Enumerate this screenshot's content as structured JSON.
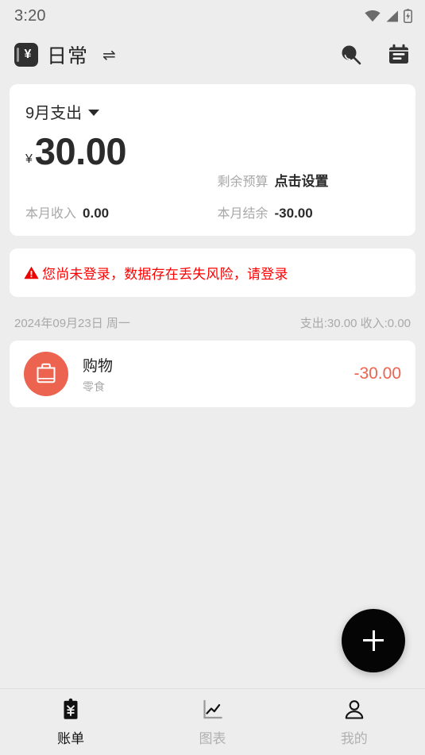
{
  "status_bar": {
    "time": "3:20",
    "icons": [
      "wifi-icon",
      "signal-icon",
      "battery-charging-icon"
    ]
  },
  "app_bar": {
    "logo_symbol": "¥",
    "logo_icon": "ledger-book-icon",
    "title": "日常",
    "swap_glyph": "⇌",
    "actions": [
      {
        "name": "search-icon",
        "label": "搜索"
      },
      {
        "name": "calendar-bill-icon",
        "label": "账本"
      }
    ]
  },
  "summary": {
    "month_label": "9月支出",
    "currency_symbol": "¥",
    "expense_amount": "30.00",
    "budget_label": "剩余预算",
    "budget_value": "点击设置",
    "income_label": "本月收入",
    "income_value": "0.00",
    "balance_label": "本月结余",
    "balance_value": "-30.00"
  },
  "warning": {
    "icon": "warning-triangle-icon",
    "text": "您尚未登录，数据存在丢失风险，请登录",
    "color": "#ff0000"
  },
  "day_group": {
    "date": "2024年09月23日 周一",
    "totals": "支出:30.00  收入:0.00"
  },
  "transactions": [
    {
      "icon": "shopping-bag-icon",
      "icon_color": "#ec6350",
      "category": "购物",
      "note": "零食",
      "amount": "-30.00",
      "amount_color": "#ec6350"
    }
  ],
  "fab": {
    "icon": "plus-icon",
    "label": "添加记账"
  },
  "bottom_nav": {
    "items": [
      {
        "icon": "bill-clipboard-icon",
        "label": "账单",
        "active": true
      },
      {
        "icon": "chart-line-icon",
        "label": "图表",
        "active": false
      },
      {
        "icon": "person-icon",
        "label": "我的",
        "active": false
      }
    ]
  },
  "colors": {
    "background": "#ededed",
    "card": "#ffffff",
    "accent": "#ec6350",
    "danger": "#ff0000",
    "text_primary": "#2b2b2b",
    "text_muted": "#a9a9a9"
  }
}
